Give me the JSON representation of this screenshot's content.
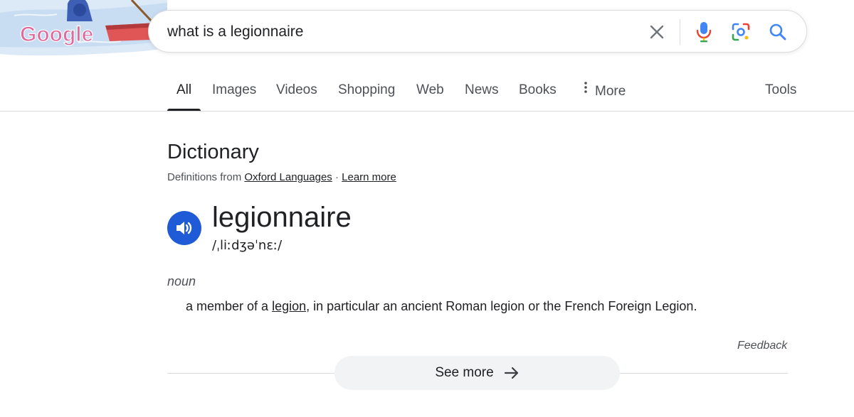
{
  "logo": {
    "text": "Google"
  },
  "search": {
    "query": "what is a legionnaire",
    "placeholder": "",
    "clear_icon": "close-icon",
    "mic_icon": "microphone-icon",
    "lens_icon": "lens-icon",
    "search_icon": "search-icon"
  },
  "tabs": {
    "items": [
      {
        "label": "All",
        "active": true
      },
      {
        "label": "Images"
      },
      {
        "label": "Videos"
      },
      {
        "label": "Shopping"
      },
      {
        "label": "Web"
      },
      {
        "label": "News"
      },
      {
        "label": "Books"
      },
      {
        "label": "More"
      }
    ],
    "tools": "Tools"
  },
  "dictionary": {
    "title": "Dictionary",
    "source_prefix": "Definitions from",
    "source_link": "Oxford Languages",
    "separator": "·",
    "learn_more": "Learn more",
    "word": "legionnaire",
    "phonetic": "/ˌliːdʒəˈnɛː/",
    "part_of_speech": "noun",
    "definition_prefix": "a member of a",
    "definition_link": "legion",
    "definition_suffix": ", in particular an ancient Roman legion or the French Foreign Legion.",
    "feedback": "Feedback",
    "see_more": "See more"
  },
  "colors": {
    "accent_blue": "#1f5bd6",
    "text": "#202124",
    "muted": "#4d5156",
    "border": "#dadce0"
  }
}
